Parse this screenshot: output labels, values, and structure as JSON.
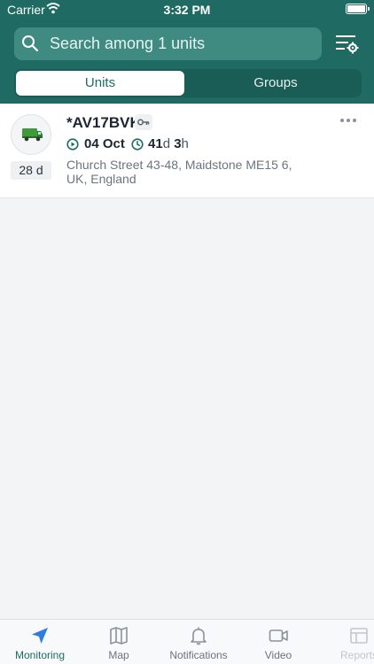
{
  "status_bar": {
    "carrier": "Carrier",
    "time": "3:32 PM"
  },
  "search": {
    "placeholder": "Search among 1 units"
  },
  "segments": [
    {
      "label": "Units",
      "selected": true
    },
    {
      "label": "Groups",
      "selected": false
    }
  ],
  "unit": {
    "name": "*AV17BVK",
    "age": "28 d",
    "date": "04 Oct",
    "duration_days": "41",
    "duration_days_unit": "d",
    "duration_hours": "3",
    "duration_hours_unit": "h",
    "address": "Church Street 43-48, Maidstone ME15 6, UK, England",
    "icon": "truck-icon",
    "icon_color": "#3f9a3b"
  },
  "tabs": [
    {
      "label": "Monitoring",
      "icon": "location-arrow-icon",
      "active": true
    },
    {
      "label": "Map",
      "icon": "map-icon",
      "active": false
    },
    {
      "label": "Notifications",
      "icon": "bell-icon",
      "active": false
    },
    {
      "label": "Video",
      "icon": "video-icon",
      "active": false
    },
    {
      "label": "Reports",
      "icon": "reports-icon",
      "active": false
    }
  ],
  "colors": {
    "brand": "#1f6b63",
    "accent_blue": "#2f7de1"
  }
}
